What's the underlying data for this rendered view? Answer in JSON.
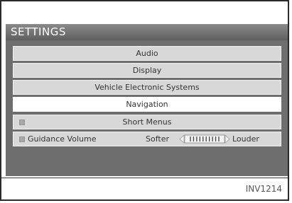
{
  "screen": {
    "title": "SETTINGS",
    "menu": [
      {
        "label": "Audio"
      },
      {
        "label": "Display"
      },
      {
        "label": "Vehicle Electronic Systems"
      },
      {
        "label": "Navigation",
        "selected": true
      },
      {
        "label": "Short Menus",
        "has_indicator": true
      }
    ],
    "guidance_volume": {
      "label": "Guidance Volume",
      "softer_label": "Softer",
      "louder_label": "Louder",
      "level_fraction": 0.5
    }
  },
  "figure_code": "INV1214",
  "colors": {
    "screen_bg": "#6e6e6e",
    "button_bg": "#d8d8d8",
    "selected_bg": "#ffffff"
  }
}
